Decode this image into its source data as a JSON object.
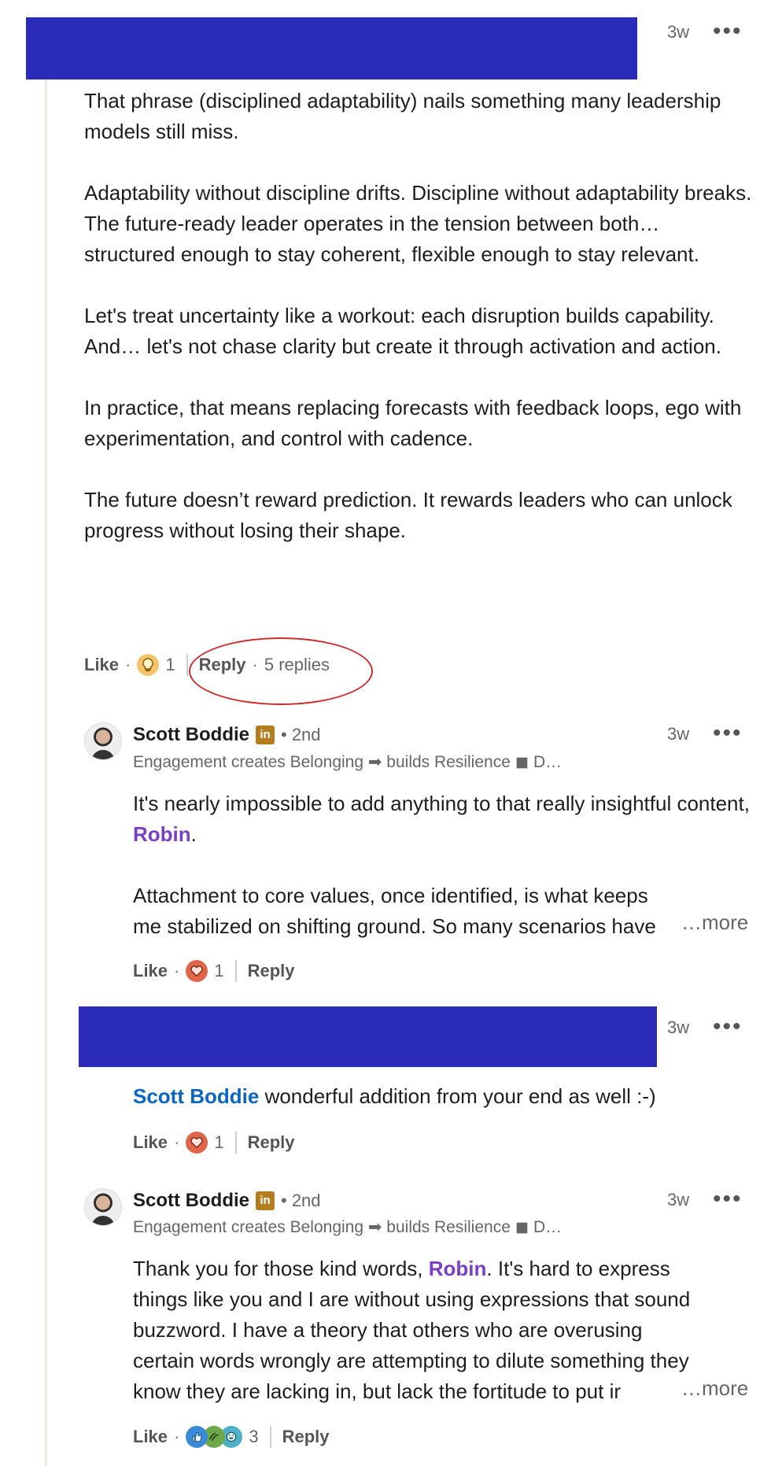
{
  "comment1": {
    "time": "3w",
    "paragraphs": [
      "That phrase (disciplined adaptability) nails something many leadership models still miss.",
      "Adaptability without discipline drifts. Discipline without adaptability breaks. The future-ready leader operates in the tension between both… structured enough to stay coherent, flexible enough to stay relevant.",
      "Let's treat uncertainty like a workout: each disruption builds capability.\nAnd… let's not chase clarity but create it through activation and action.",
      "In practice, that means replacing forecasts with feedback loops, ego with experimentation, and control with cadence.",
      "The future doesn’t reward prediction. It rewards leaders who can unlock progress without losing their shape."
    ],
    "like_label": "Like",
    "reaction_count": "1",
    "reply_label": "Reply",
    "replies_label": "5 replies",
    "colors": {
      "redaction": "#2b2bb9",
      "annotation": "#cc2b2b"
    }
  },
  "reply1": {
    "author": "Scott Boddie",
    "badge": "in",
    "degree": "• 2nd",
    "headline": "Engagement creates Belonging ➡ builds Resilience  ◼  D…",
    "time": "3w",
    "text_before": "It's nearly impossible to add anything to that really insightful content,",
    "mention": "Robin",
    "text_after": ".",
    "text2": "Attachment to core values, once identified, is what keeps me stabilized on shifting ground. So many scenarios have",
    "more": "…more",
    "like_label": "Like",
    "reaction_count": "1",
    "reply_label": "Reply"
  },
  "reply2": {
    "time": "3w",
    "mention": "Scott Boddie",
    "text": " wonderful addition from your end as well :-)",
    "like_label": "Like",
    "reaction_count": "1",
    "reply_label": "Reply"
  },
  "reply3": {
    "author": "Scott Boddie",
    "badge": "in",
    "degree": "• 2nd",
    "headline": "Engagement creates Belonging ➡ builds Resilience  ◼  D…",
    "time": "3w",
    "text_before": "Thank you for those kind words,",
    "mention": "Robin",
    "text_after": ". It's hard to express things like you and I are without using expressions that sound buzzword. I have a theory that others who are overusing certain words wrongly are attempting to dilute something they know they are lacking in, but lack the fortitude to put ir",
    "more": "…more",
    "like_label": "Like",
    "reaction_count": "3",
    "reply_label": "Reply"
  },
  "icons": {
    "more_menu": "more-horizontal-icon",
    "insightful": "lightbulb-icon",
    "love": "heart-icon",
    "like_reaction": "thumbs-up-icon",
    "support": "support-hands-icon",
    "funny": "laugh-icon"
  }
}
